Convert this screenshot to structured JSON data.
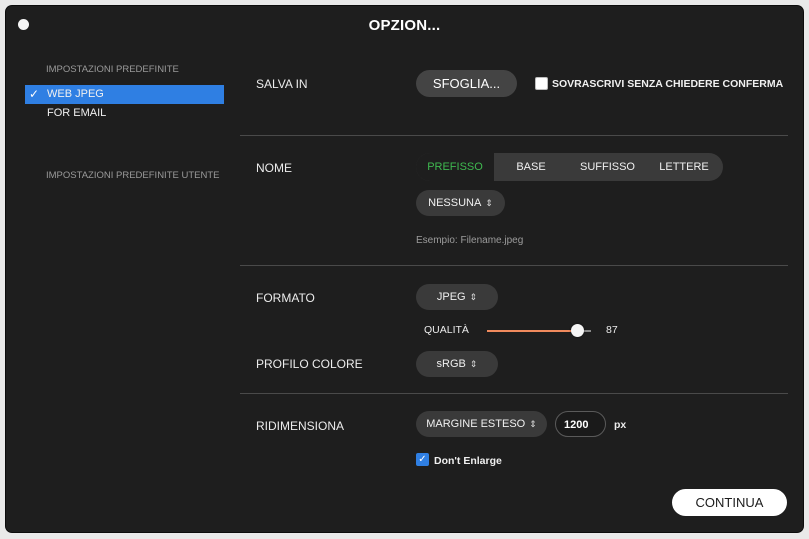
{
  "window": {
    "title": "OPZION..."
  },
  "sidebar": {
    "presets_header": "IMPOSTAZIONI PREDEFINITE",
    "items": [
      {
        "label": "WEB JPEG",
        "selected": true
      },
      {
        "label": "FOR EMAIL",
        "selected": false
      }
    ],
    "user_presets_header": "IMPOSTAZIONI PREDEFINITE UTENTE"
  },
  "save_in": {
    "label": "SALVA IN",
    "browse_label": "SFOGLIA...",
    "overwrite_label": "SOVRASCRIVI SENZA CHIEDERE CONFERMA",
    "overwrite_checked": false
  },
  "name": {
    "label": "NOME",
    "segments": [
      "PREFISSO",
      "BASE",
      "SUFFISSO",
      "LETTERE"
    ],
    "active_segment": "PREFISSO",
    "prefix_select": "NESSUNA",
    "example": "Esempio: Filename.jpeg"
  },
  "format": {
    "label": "FORMATO",
    "value": "JPEG",
    "quality_label": "QUALITÀ",
    "quality_value": "87",
    "quality_fraction": 0.87
  },
  "color_profile": {
    "label": "PROFILO COLORE",
    "value": "sRGB"
  },
  "resize": {
    "label": "RIDIMENSIONA",
    "mode": "MARGINE ESTESO",
    "pixels": "1200",
    "unit": "px",
    "dont_enlarge_label": "Don't Enlarge",
    "dont_enlarge_checked": true
  },
  "footer": {
    "continue_label": "CONTINUA"
  },
  "colors": {
    "accent": "#2f7fe3",
    "active_segment_text": "#3fb950",
    "slider_fill": "#f08a5d"
  }
}
